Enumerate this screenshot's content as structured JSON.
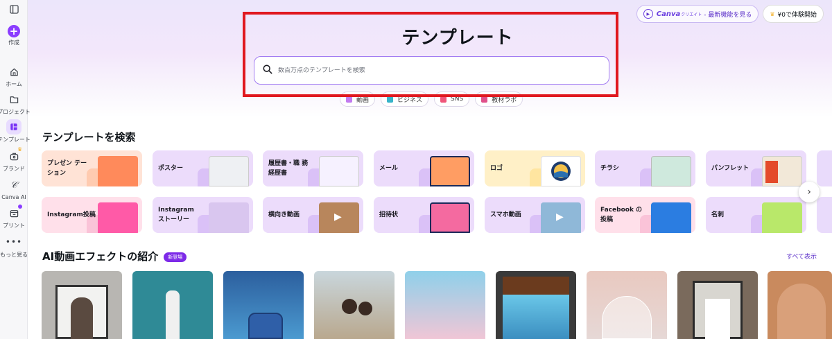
{
  "sidebar": {
    "toggle_icon": "panel-toggle-icon",
    "items": [
      {
        "label": "作成",
        "icon": "plus-icon"
      },
      {
        "label": "ホーム",
        "icon": "home-icon"
      },
      {
        "label": "プロジェクト",
        "icon": "folder-icon"
      },
      {
        "label": "テンプレート",
        "icon": "template-icon"
      },
      {
        "label": "ブランド",
        "icon": "brand-icon"
      },
      {
        "label": "Canva AI",
        "icon": "canva-ai-icon"
      },
      {
        "label": "プリント",
        "icon": "print-icon"
      },
      {
        "label": "もっと見る",
        "icon": "more-icon"
      }
    ]
  },
  "header": {
    "canva_create_logo": "Canva",
    "canva_create_logo_small": "クリエイト",
    "canva_create_label": "- 最新機能を見る",
    "trial_label": "¥0で体験開始"
  },
  "hero": {
    "title": "テンプレート",
    "search_placeholder": "数百万点のテンプレートを検索",
    "pills": [
      {
        "label": "動画",
        "color": "#c27af0"
      },
      {
        "label": "ビジネス",
        "color": "#36b3c9"
      },
      {
        "label": "SNS",
        "color": "#f0567a"
      },
      {
        "label": "教材ラボ",
        "color": "#e0508a"
      }
    ]
  },
  "templates_section": {
    "title": "テンプレートを検索",
    "row1": [
      {
        "label": "プレゼン テーション",
        "bg": "#ffe3d6",
        "thumb": "#ff8a5b"
      },
      {
        "label": "ポスター",
        "bg": "#ecdcfb",
        "thumb": "#eef0f3"
      },
      {
        "label": "履歴書・職 務経歴書",
        "bg": "#ecdcfb",
        "thumb": "#f6f1ff"
      },
      {
        "label": "メール",
        "bg": "#ecdcfb",
        "thumb": "#ff9d63"
      },
      {
        "label": "ロゴ",
        "bg": "#fff0c7",
        "thumb": "#ffffff"
      },
      {
        "label": "チラシ",
        "bg": "#ecdcfb",
        "thumb": "#cfe9dd"
      },
      {
        "label": "パンフレット",
        "bg": "#ecdcfb",
        "thumb": "#f2e8d8"
      }
    ],
    "row2": [
      {
        "label": "Instagram投稿",
        "bg": "#ffe0ea",
        "thumb": "#ff5aa7"
      },
      {
        "label": "Instagram ストーリー",
        "bg": "#ecdcfb",
        "thumb": "#d9c6ef"
      },
      {
        "label": "横向き動画",
        "bg": "#ecdcfb",
        "thumb": "#b8865c"
      },
      {
        "label": "招待状",
        "bg": "#ecdcfb",
        "thumb": "#f46aa0"
      },
      {
        "label": "スマホ動画",
        "bg": "#ecdcfb",
        "thumb": "#8fb8d8"
      },
      {
        "label": "Facebook の投稿",
        "bg": "#ffe0ea",
        "thumb": "#2b7de1"
      },
      {
        "label": "名刺",
        "bg": "#ecdcfb",
        "thumb": "#b9e86a"
      }
    ]
  },
  "ai_section": {
    "title": "AI動画エフェクトの紹介",
    "badge": "新登場",
    "see_all": "すべて表示",
    "videos": [
      {
        "name": "video-thumb-1",
        "bg": "#b8b6b2"
      },
      {
        "name": "video-thumb-2",
        "bg": "#2f8a96"
      },
      {
        "name": "video-thumb-3",
        "bg": "#3f77b8"
      },
      {
        "name": "video-thumb-4",
        "bg": "#c9b89e"
      },
      {
        "name": "video-thumb-5",
        "bg": "#9fd4e6"
      },
      {
        "name": "video-thumb-6",
        "bg": "#3a3a3a"
      },
      {
        "name": "video-thumb-7",
        "bg": "#e6cfcf"
      },
      {
        "name": "video-thumb-8",
        "bg": "#7a6a5c"
      },
      {
        "name": "video-thumb-9",
        "bg": "#c98a5e"
      }
    ]
  }
}
